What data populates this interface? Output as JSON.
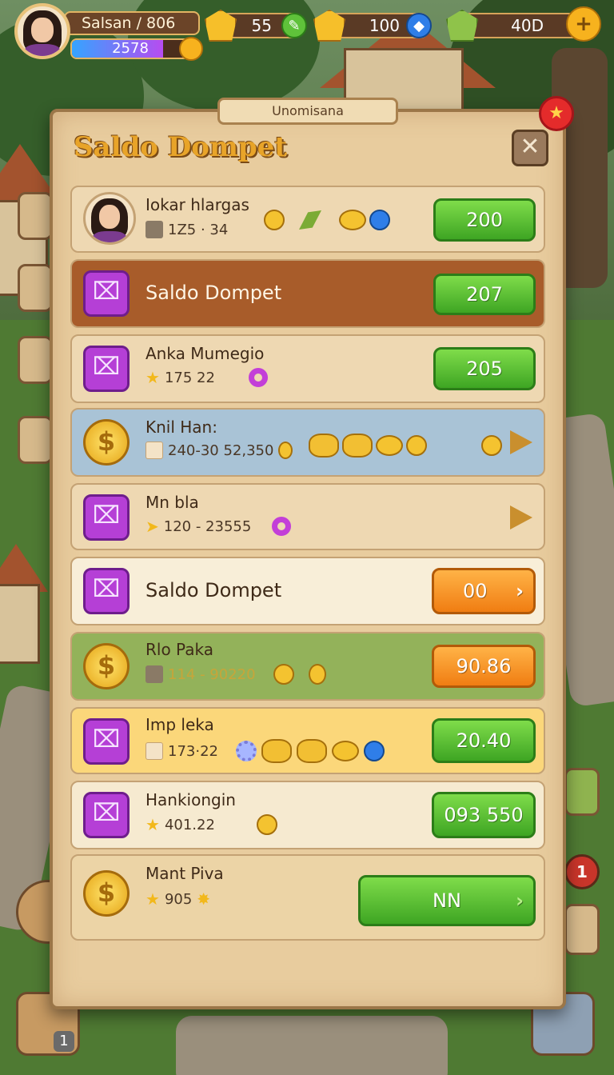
{
  "player": {
    "name": "Salsan / 806",
    "xp_text": "2578",
    "xp_progress": 0.78
  },
  "resources": [
    {
      "value": "55",
      "icon": "gold-gem-icon",
      "badge_icon": "leaf-icon"
    },
    {
      "value": "100",
      "icon": "gold-gem-icon",
      "badge_icon": "blue-gem-icon"
    },
    {
      "value": "40D",
      "icon": "sprout-icon",
      "badge_icon": "plus-icon",
      "badge_label": "+"
    }
  ],
  "panel": {
    "tab_label": "Unomisana",
    "title": "Saldo Dompet",
    "close_label": "✕",
    "notify_label": "★"
  },
  "rows": [
    {
      "title": "Iokar hlargas",
      "sub": "1Z5 · 34",
      "button": "200",
      "button_style": "green",
      "row_bg": "#eed8b2"
    },
    {
      "title": "Saldo Dompet",
      "button": "207",
      "button_style": "green",
      "row_bg": "#a85c2a"
    },
    {
      "title": "Anka Mumegio",
      "sub": "175 22",
      "button": "205",
      "button_style": "green",
      "row_bg": "#eed8b2"
    },
    {
      "title": "Knil Han:",
      "sub": "240-30 52,350",
      "row_bg": "#a9c3d6"
    },
    {
      "title": "Mn bla",
      "sub": "120 - 23555",
      "row_bg": "#eed8b2"
    },
    {
      "title": "Saldo Dompet",
      "button": "00",
      "button_style": "orange",
      "row_bg": "#f8eed8"
    },
    {
      "title": "Rlo Paka",
      "sub": "114 - 90220",
      "button": "90.86",
      "button_style": "orange",
      "row_bg": "#93b25a"
    },
    {
      "title": "Imp leka",
      "sub": "173·22",
      "button": "20.40",
      "button_style": "green",
      "row_bg": "#fbd77a"
    },
    {
      "title": "Hankiongin",
      "sub": "401.22",
      "button": "093 550",
      "button_style": "green",
      "row_bg": "#f6ead0"
    },
    {
      "title": "Mant Piva",
      "sub": "905",
      "button": "NN",
      "button_style": "green",
      "row_bg": "#ecd4a6"
    }
  ],
  "side": {
    "bottom_left_badge": "1",
    "right_badge": "1"
  },
  "colors": {
    "accent_green": "#3ea523",
    "accent_orange": "#f07d12",
    "title_gold": "#e8a429",
    "panel_bg": "#e8cc9e"
  }
}
